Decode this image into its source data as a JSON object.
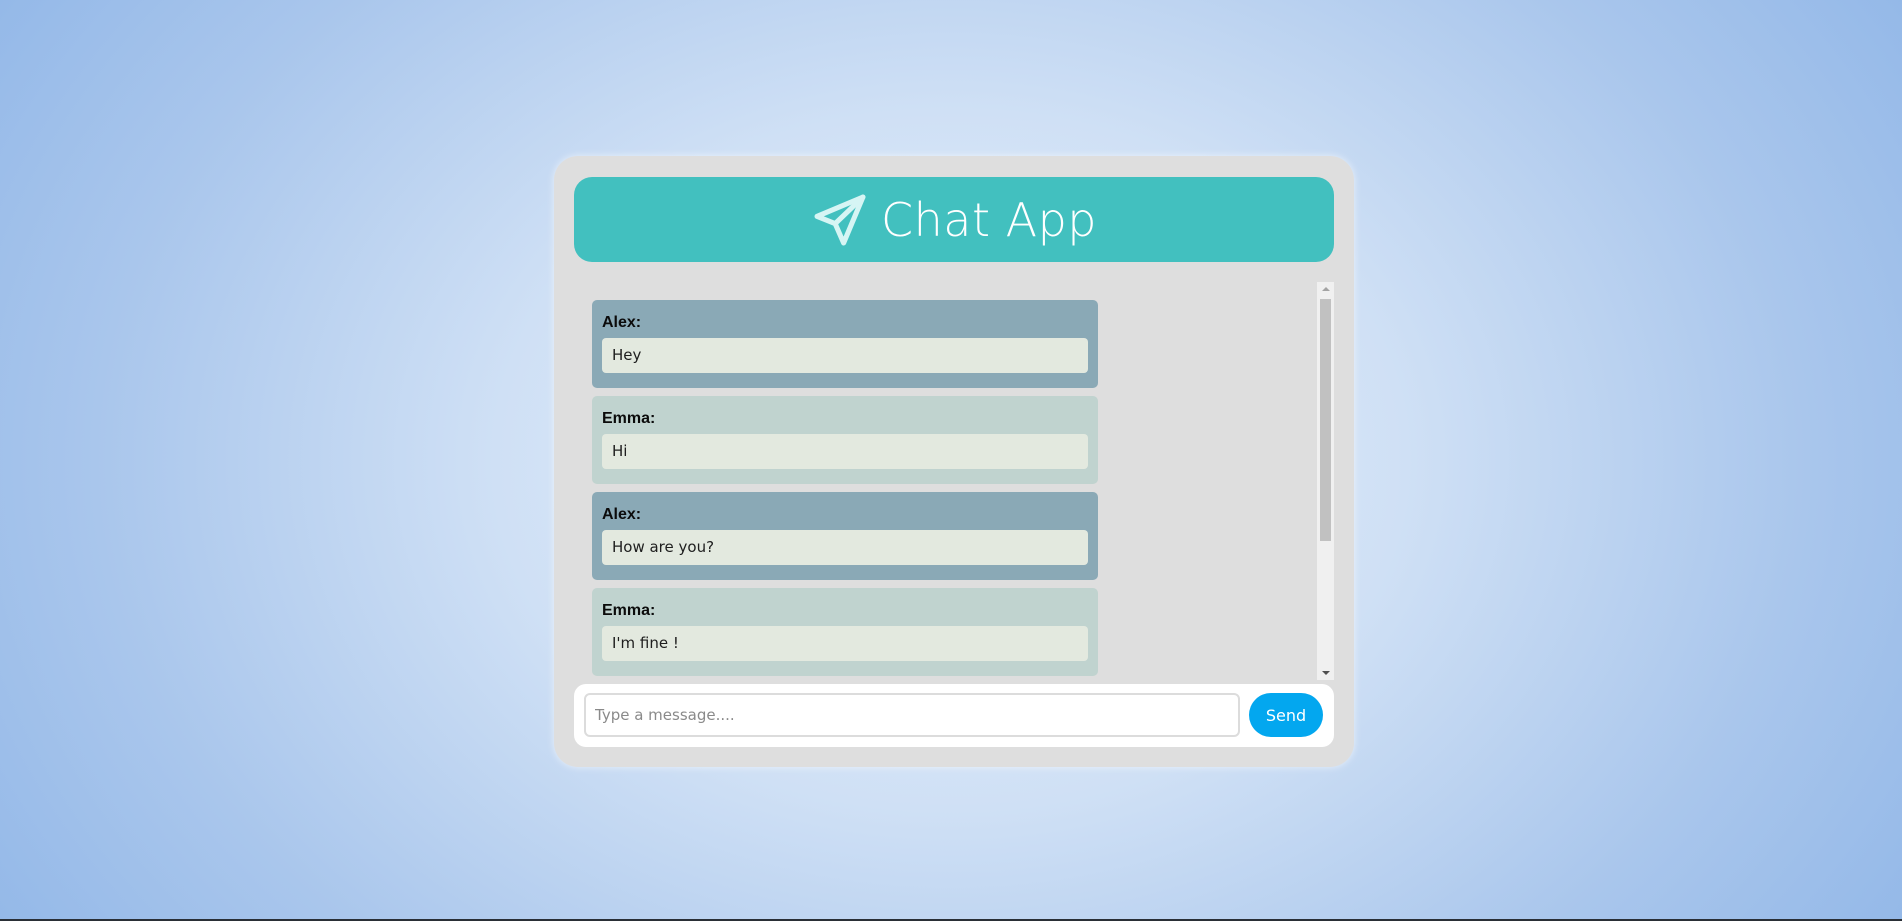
{
  "app": {
    "title": "Chat App",
    "icon": "paper-plane-icon"
  },
  "messages": [
    {
      "sender": "Alex:",
      "text": "Hey",
      "style": "alex"
    },
    {
      "sender": "Emma:",
      "text": "Hi",
      "style": "emma"
    },
    {
      "sender": "Alex:",
      "text": "How are you?",
      "style": "alex"
    },
    {
      "sender": "Emma:",
      "text": "I'm fine !",
      "style": "emma"
    }
  ],
  "composer": {
    "placeholder": "Type a message....",
    "value": "",
    "send_label": "Send"
  },
  "colors": {
    "header": "#42c0bf",
    "alex_bubble": "#8aa9b6",
    "emma_bubble": "#c0d3cf",
    "message_text_bg": "#e3e9df",
    "send_button": "#03a7ef"
  }
}
